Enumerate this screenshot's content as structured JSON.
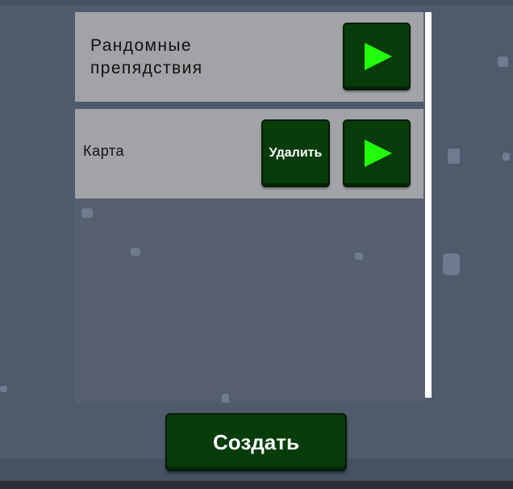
{
  "levels": [
    {
      "name": "Рандомные\nпрепядствия",
      "play_icon": "play-icon"
    },
    {
      "name": "Карта",
      "delete_label": "Удалить",
      "play_icon": "play-icon"
    }
  ],
  "create_label": "Создать",
  "colors": {
    "background": "#4f5a6c",
    "row": "#a2a3a7",
    "button": "#063c0a",
    "play_icon": "#22ff0a"
  }
}
